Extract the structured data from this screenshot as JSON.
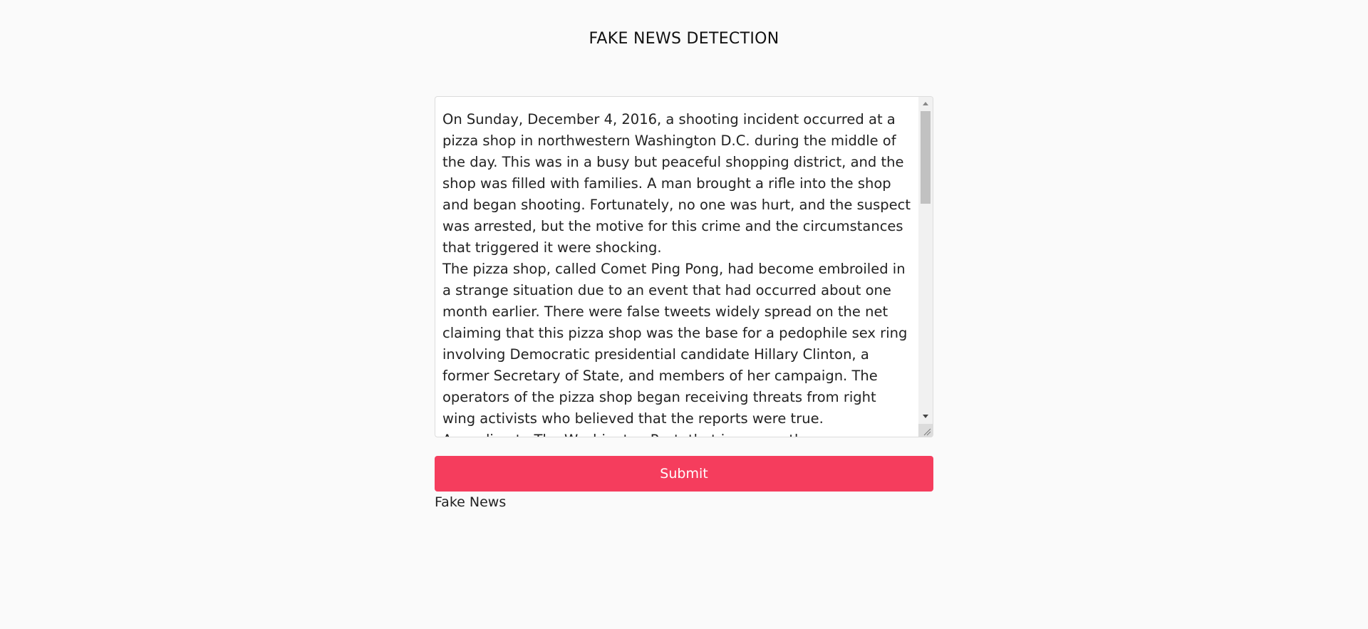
{
  "header": {
    "title": "FAKE NEWS DETECTION"
  },
  "input": {
    "text": "On Sunday, December 4, 2016, a shooting incident occurred at a pizza shop in northwestern Washington D.C. during the middle of the day. This was in a busy but peaceful shopping district, and the shop was filled with families. A man brought a rifle into the shop and began shooting. Fortunately, no one was hurt, and the suspect was arrested, but the motive for this crime and the circumstances that triggered it were shocking.\nThe pizza shop, called Comet Ping Pong, had become embroiled in a strange situation due to an event that had occurred about one month earlier. There were false tweets widely spread on the net claiming that this pizza shop was the base for a pedophile sex ring involving Democratic presidential candidate Hillary Clinton, a former Secretary of State, and members of her campaign. The operators of the pizza shop began receiving threats from right wing activists who believed that the reports were true.\nAccording to The Washington Post, that is among the many news reports"
  },
  "actions": {
    "submit_label": "Submit"
  },
  "result": {
    "label": "Fake News"
  },
  "colors": {
    "submit_bg": "#f53d5d",
    "page_bg": "#fafafa"
  }
}
